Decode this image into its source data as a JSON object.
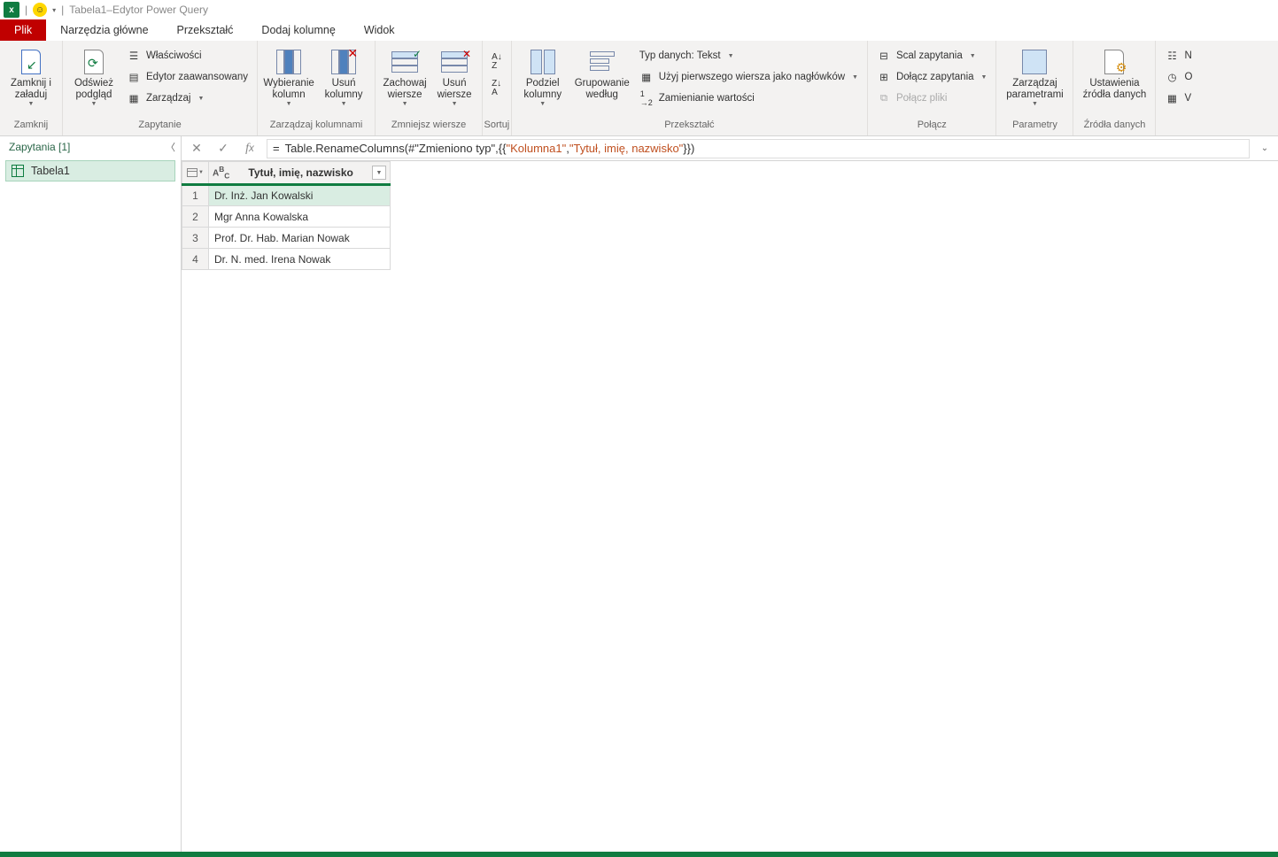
{
  "title": "Tabela1–Edytor Power Query",
  "tabs": {
    "file": "Plik",
    "home": "Narzędzia główne",
    "transform": "Przekształć",
    "addcol": "Dodaj kolumnę",
    "view": "Widok"
  },
  "ribbon": {
    "close": {
      "label": "Zamknij i\nzaładuj",
      "group": "Zamknij"
    },
    "query": {
      "refresh": "Odśwież\npodgląd",
      "properties": "Właściwości",
      "advanced": "Edytor zaawansowany",
      "manage": "Zarządzaj",
      "group": "Zapytanie"
    },
    "cols": {
      "choose": "Wybieranie\nkolumn",
      "remove": "Usuń\nkolumny",
      "group": "Zarządzaj kolumnami"
    },
    "rows": {
      "keep": "Zachowaj\nwiersze",
      "remove": "Usuń\nwiersze",
      "group": "Zmniejsz wiersze"
    },
    "sort": {
      "group": "Sortuj"
    },
    "transform": {
      "split": "Podziel\nkolumny",
      "groupby": "Grupowanie\nwedług",
      "datatype": "Typ danych: Tekst",
      "firstrow": "Użyj pierwszego wiersza jako nagłówków",
      "replace": "Zamienianie wartości",
      "group": "Przekształć"
    },
    "combine": {
      "merge": "Scal zapytania",
      "append": "Dołącz zapytania",
      "files": "Połącz pliki",
      "group": "Połącz"
    },
    "params": {
      "label": "Zarządzaj\nparametrami",
      "group": "Parametry"
    },
    "sources": {
      "settings": "Ustawienia\nźródła danych",
      "group": "Źródła danych"
    }
  },
  "sidebar": {
    "header": "Zapytania [1]",
    "items": [
      "Tabela1"
    ]
  },
  "formula": {
    "prefix": "Table.RenameColumns(#\"Zmieniono typ\",{{",
    "str1": "\"Kolumna1\"",
    "mid": ", ",
    "str2": "\"Tytuł, imię, nazwisko\"",
    "suffix": "}})"
  },
  "grid": {
    "col1": "Tytuł, imię, nazwisko",
    "rows": [
      "Dr. Inż. Jan Kowalski",
      "Mgr Anna Kowalska",
      "Prof. Dr. Hab. Marian Nowak",
      "Dr. N. med. Irena Nowak"
    ]
  }
}
